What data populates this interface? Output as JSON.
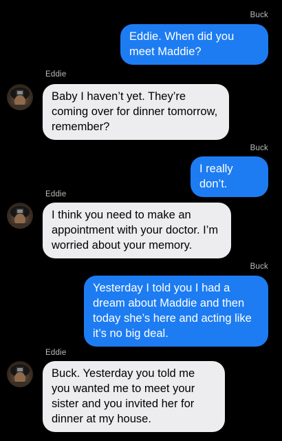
{
  "messages": [
    {
      "sender": "Buck",
      "side": "out",
      "text": "Eddie. When did you meet Maddie?"
    },
    {
      "sender": "Eddie",
      "side": "in",
      "text": "Baby I haven’t yet. They’re coming over for dinner tomorrow, remember?"
    },
    {
      "sender": "Buck",
      "side": "out",
      "text": "I really don’t."
    },
    {
      "sender": "Eddie",
      "side": "in",
      "text": "I think you need to make an appointment with your doctor. I’m worried about your memory."
    },
    {
      "sender": "Buck",
      "side": "out",
      "text": "Yesterday I told you I had a dream about Maddie and then today she’s here and acting like it’s no big deal."
    },
    {
      "sender": "Eddie",
      "side": "in",
      "text": "Buck. Yesterday you told me you wanted me to meet your sister and you invited her for dinner at my house."
    }
  ],
  "colors": {
    "background": "#000000",
    "outgoing_bubble": "#1d7cf2",
    "incoming_bubble": "#ededef",
    "sender_label": "#bdbdbd"
  },
  "icons": {
    "contact_avatar": "firefighter-helmet-avatar"
  }
}
